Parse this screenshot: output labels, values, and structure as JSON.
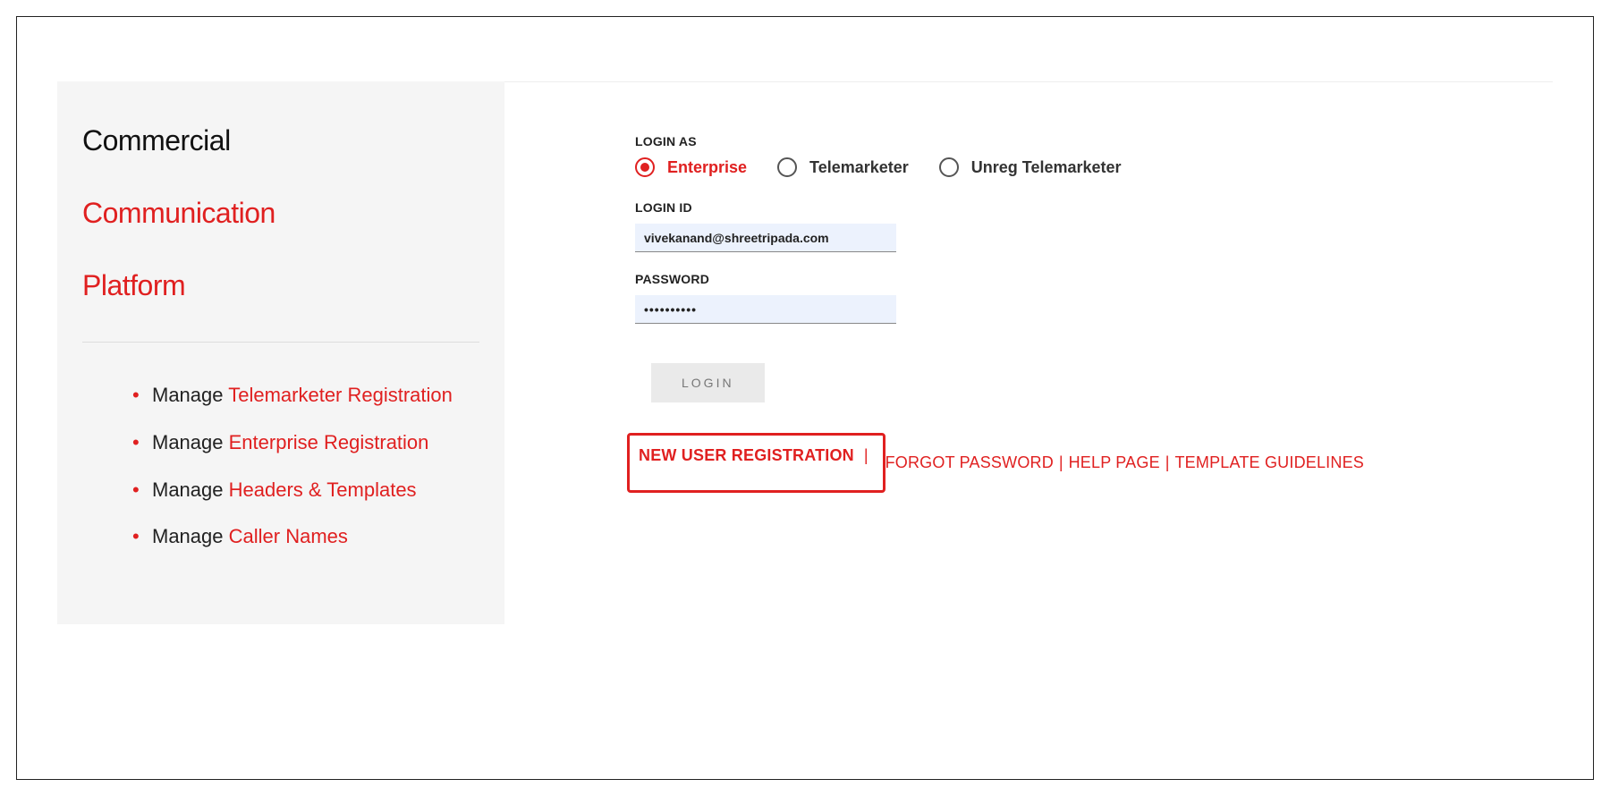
{
  "sidebar": {
    "title1": "Commercial",
    "title2": "Communication",
    "title3": "Platform",
    "items": [
      {
        "prefix": "Manage ",
        "link": "Telemarketer Registration"
      },
      {
        "prefix": "Manage ",
        "link": "Enterprise Registration"
      },
      {
        "prefix": "Manage ",
        "link": "Headers & Templates"
      },
      {
        "prefix": "Manage ",
        "link": "Caller Names"
      }
    ]
  },
  "form": {
    "login_as_label": "LOGIN AS",
    "radios": {
      "enterprise": "Enterprise",
      "telemarketer": "Telemarketer",
      "unreg": "Unreg Telemarketer"
    },
    "login_id_label": "LOGIN ID",
    "login_id_value": "vivekanand@shreetripada.com",
    "password_label": "PASSWORD",
    "password_value": "••••••••••",
    "login_button": "LOGIN"
  },
  "links": {
    "new_user": "NEW USER REGISTRATION",
    "forgot": "FORGOT PASSWORD",
    "help": "HELP PAGE",
    "templates": "TEMPLATE GUIDELINES",
    "sep": "|"
  }
}
